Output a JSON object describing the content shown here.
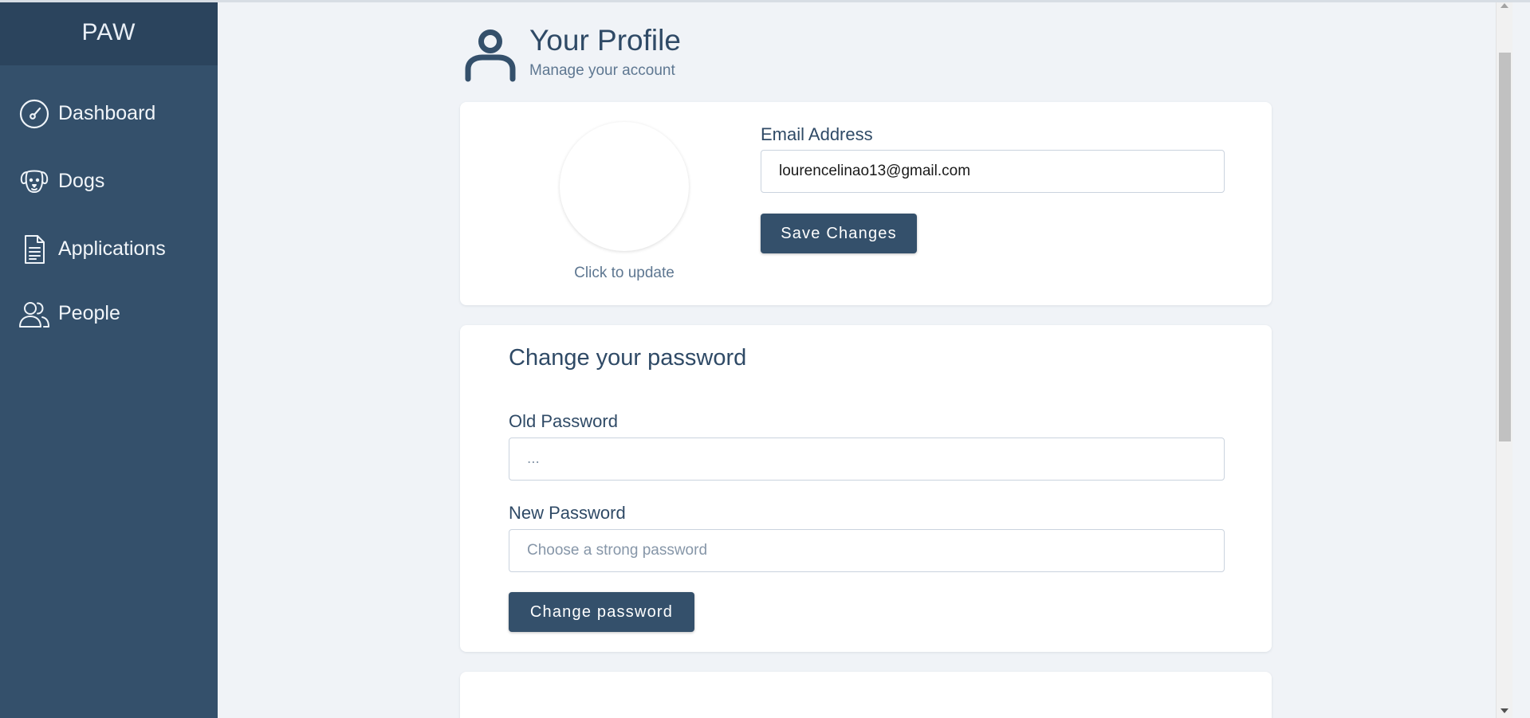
{
  "app": {
    "brand": "PAW"
  },
  "sidebar": {
    "items": [
      {
        "label": "Dashboard",
        "icon": "gauge-icon"
      },
      {
        "label": "Dogs",
        "icon": "dog-icon"
      },
      {
        "label": "Applications",
        "icon": "document-icon"
      },
      {
        "label": "People",
        "icon": "people-icon"
      }
    ]
  },
  "header": {
    "title": "Your Profile",
    "subtitle": "Manage your account",
    "icon": "user-icon"
  },
  "profile_card": {
    "photo_caption": "Click to update",
    "email_label": "Email Address",
    "email_value": "lourencelinao13@gmail.com",
    "save_label": "Save Changes"
  },
  "password_card": {
    "title": "Change your password",
    "old_label": "Old Password",
    "old_placeholder": "...",
    "new_label": "New Password",
    "new_placeholder": "Choose a strong password",
    "submit_label": "Change password"
  },
  "colors": {
    "sidebar_bg": "#34506b",
    "brand_bg": "#2b445d",
    "page_bg": "#f0f3f7",
    "accent": "#34506b",
    "text": "#2f4a66"
  }
}
